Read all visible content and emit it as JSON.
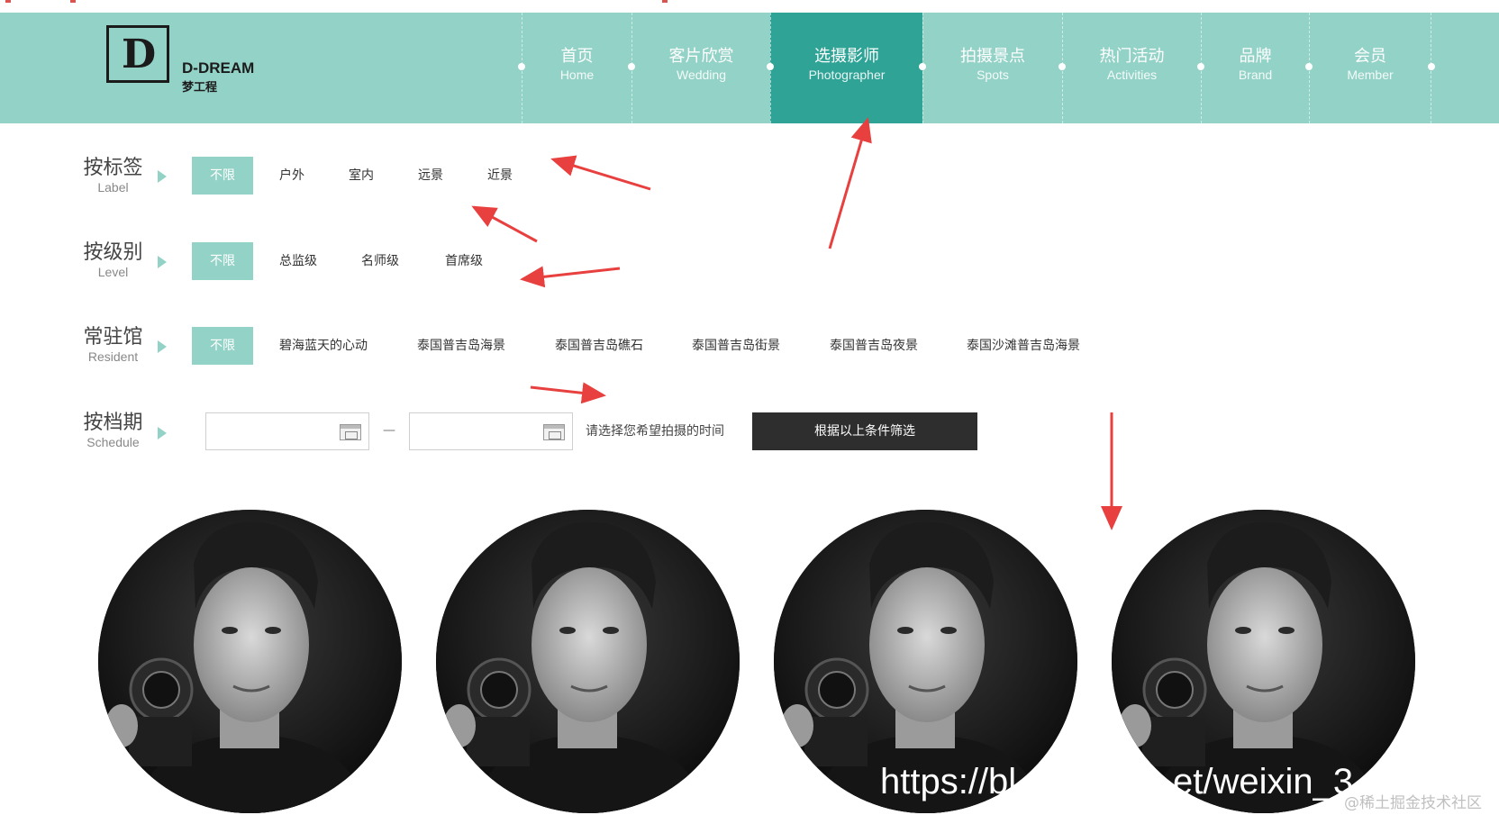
{
  "brand": {
    "logo_letter": "D",
    "name_en": "D-DREAM",
    "name_cn": "梦工程"
  },
  "nav": {
    "items": [
      {
        "cn": "首页",
        "en": "Home",
        "active": false
      },
      {
        "cn": "客片欣赏",
        "en": "Wedding",
        "active": false
      },
      {
        "cn": "选摄影师",
        "en": "Photographer",
        "active": true
      },
      {
        "cn": "拍摄景点",
        "en": "Spots",
        "active": false
      },
      {
        "cn": "热门活动",
        "en": "Activities",
        "active": false
      },
      {
        "cn": "品牌",
        "en": "Brand",
        "active": false
      },
      {
        "cn": "会员",
        "en": "Member",
        "active": false
      }
    ]
  },
  "filters": {
    "label": {
      "cn": "按标签",
      "en": "Label",
      "options": [
        "不限",
        "户外",
        "室内",
        "远景",
        "近景"
      ]
    },
    "level": {
      "cn": "按级别",
      "en": "Level",
      "options": [
        "不限",
        "总监级",
        "名师级",
        "首席级"
      ]
    },
    "resident": {
      "cn": "常驻馆",
      "en": "Resident",
      "options": [
        "不限",
        "碧海蓝天的心动",
        "泰国普吉岛海景",
        "泰国普吉岛礁石",
        "泰国普吉岛街景",
        "泰国普吉岛夜景",
        "泰国沙滩普吉岛海景"
      ]
    },
    "schedule": {
      "cn": "按档期",
      "en": "Schedule",
      "start_value": "",
      "end_value": "",
      "separator": "—",
      "hint": "请选择您希望拍摄的时间",
      "button": "根据以上条件筛选"
    }
  },
  "photographers": [
    {
      "icon": "photographer-portrait"
    },
    {
      "icon": "photographer-portrait"
    },
    {
      "icon": "photographer-portrait"
    },
    {
      "icon": "photographer-portrait"
    }
  ],
  "colors": {
    "nav_bg": "#93d2c7",
    "nav_active": "#2ea396",
    "chip_active": "#93d2c7",
    "button_bg": "#2e2e2e",
    "annotation_arrow": "#e8403f"
  },
  "watermark": {
    "url_fragment_1": "https://bl",
    "url_fragment_2": "et/weixin_3",
    "site": "@稀土掘金技术社区"
  }
}
